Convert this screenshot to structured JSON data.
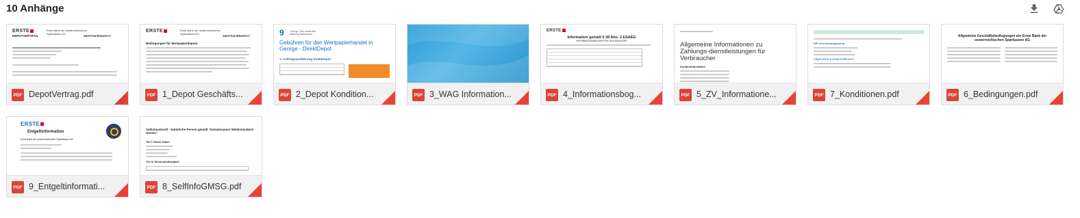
{
  "header": {
    "title": "10 Anhänge",
    "download_all_icon": "download-icon",
    "drive_icon": "google-drive-icon"
  },
  "colors": {
    "pdf_red": "#db4437",
    "corner_red": "#ea4335",
    "card_border": "#dadce0"
  },
  "attachments": [
    {
      "name": "DepotVertrag.pdf",
      "type": "PDF",
      "preview_icon": "pdf-document-preview"
    },
    {
      "name": "1_Depot Geschäfts...",
      "type": "PDF",
      "preview_icon": "pdf-document-preview"
    },
    {
      "name": "2_Depot Kondition...",
      "type": "PDF",
      "preview_icon": "pdf-document-preview"
    },
    {
      "name": "3_WAG Information...",
      "type": "PDF",
      "preview_icon": "pdf-document-preview"
    },
    {
      "name": "4_Informationsbog...",
      "type": "PDF",
      "preview_icon": "pdf-document-preview"
    },
    {
      "name": "5_ZV_Informatione...",
      "type": "PDF",
      "preview_icon": "pdf-document-preview"
    },
    {
      "name": "7_Konditionen.pdf",
      "type": "PDF",
      "preview_icon": "pdf-document-preview"
    },
    {
      "name": "6_Bedingungen.pdf",
      "type": "PDF",
      "preview_icon": "pdf-document-preview"
    },
    {
      "name": "9_Entgeltinformati...",
      "type": "PDF",
      "preview_icon": "pdf-document-preview"
    },
    {
      "name": "8_SelfInfoGMSG.pdf",
      "type": "PDF",
      "preview_icon": "pdf-document-preview"
    }
  ],
  "previews": {
    "p0": {
      "brand": "ERSTE",
      "sub": "DEPOTVERTRAG",
      "org": "Erste Bank der oesterreichischen Sparkassen AG",
      "kind": "WERTPAPIERDEPOT"
    },
    "p1": {
      "brand": "ERSTE",
      "org": "Erste Bank der oesterreichischen Sparkassen AG",
      "heading": "Bedingungen für Wertpapierdepots",
      "kind": "WERTPAPIERDEPOT"
    },
    "p2": {
      "logo_sub": "George. Das modernste Banking Österreichs.",
      "heading": "Gebühren für den Wertpapierhandel in George - DirektDepot",
      "section": "1. Auftragsausführung DirektDepot"
    },
    "p4": {
      "heading": "Information gemäß § 38 Abs. 2 ESAEG",
      "sub": "INFORMATIONSBOGEN FÜR DEN EINLEGER"
    },
    "p5": {
      "heading": "Allgemeine Informationen zu Zahlungs-dienstleistungen für Verbraucher",
      "section": "Kundeninformation"
    },
    "p6": {
      "section": "WP-Verrechnungskonto",
      "sub": "Allgemeine Kontokonditionen"
    },
    "p7": {
      "heading": "Allgemeine Geschäftsbedingungen der Erste Bank der oesterreichischen Sparkassen AG"
    },
    "p8": {
      "brand": "ERSTE",
      "heading": "Entgeltinformation",
      "org": "Erste Bank der oesterreichischen Sparkassen AG"
    },
    "p9": {
      "heading": "Selbstauskunft - Natürliche Person gemäß \"Gemeinsamer Meldestandard Gesetz\"",
      "section1": "Teil I: Meine Daten",
      "section2": "Teil II: Steueransässigkeit"
    }
  }
}
